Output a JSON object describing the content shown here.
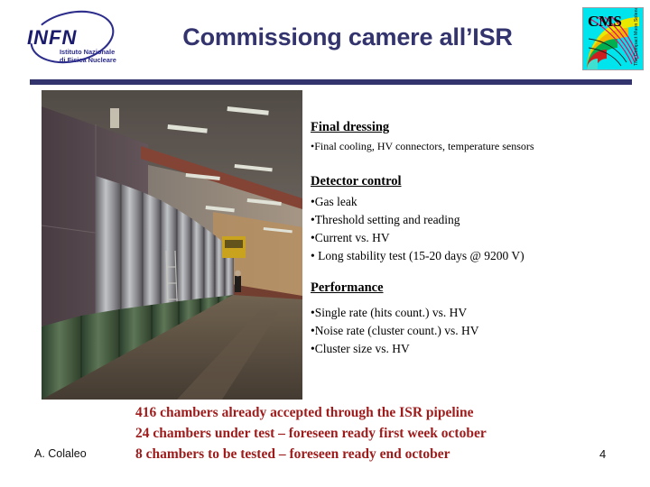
{
  "header": {
    "title": "Commissiong camere all’ISR",
    "title_color": "#33336e",
    "rule_color": "#33336e",
    "infn_logo": {
      "name": "infn-logo",
      "acronym": "INFN",
      "subtitle_line1": "Istituto Nazionale",
      "subtitle_line2": "di Fisica Nucleare",
      "color": "#2d2d8c"
    },
    "cms_logo": {
      "name": "cms-logo",
      "text": "CMS",
      "side_text": "The Compact Muon Solenoid",
      "background": "#00e6f0"
    }
  },
  "photo": {
    "name": "hall-photo",
    "caption": ""
  },
  "sections": [
    {
      "id": "final-dressing",
      "heading": "Final dressing",
      "bullets": [
        "•Final cooling, HV  connectors, temperature sensors"
      ]
    },
    {
      "id": "detector-control",
      "heading": "Detector control",
      "bullets": [
        "•Gas leak",
        "•Threshold setting and reading",
        "•Current vs. HV",
        "• Long stability test (15-20 days @ 9200 V)"
      ]
    },
    {
      "id": "performance",
      "heading": "Performance",
      "bullets": [
        "•Single rate (hits count.) vs. HV",
        "•Noise rate (cluster count.) vs. HV",
        "•Cluster size vs. HV"
      ]
    }
  ],
  "summary": {
    "color": "#9e1b1b",
    "lines": [
      "416 chambers already accepted through the ISR pipeline",
      "24 chambers under test – foreseen ready first week october",
      "8 chambers to be tested – foreseen ready end october"
    ]
  },
  "footer": {
    "author": "A. Colaleo",
    "page_number": "4"
  }
}
